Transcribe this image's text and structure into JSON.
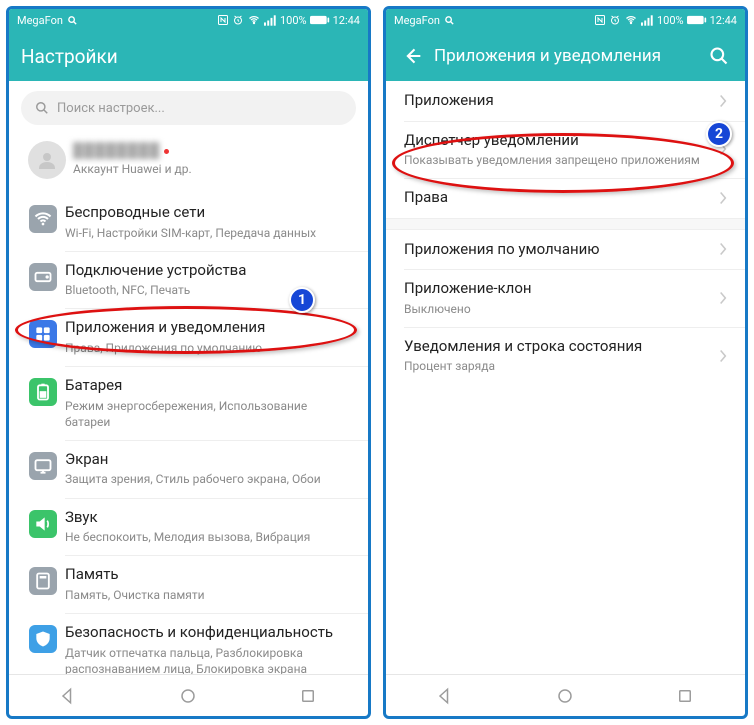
{
  "statusbar": {
    "carrier": "MegaFon",
    "battery_pct": "100%",
    "time": "12:44"
  },
  "screen1": {
    "title": "Настройки",
    "search_placeholder": "Поиск настроек...",
    "account": {
      "name_masked": "████████",
      "sub": "Аккаунт Huawei и др."
    },
    "rows": [
      {
        "title": "Беспроводные сети",
        "sub": "Wi-Fi, Настройки SIM-карт, Передача данных",
        "icon": "wifi",
        "color": "#9aa4ad"
      },
      {
        "title": "Подключение устройства",
        "sub": "Bluetooth, NFC, Печать",
        "icon": "link",
        "color": "#9aa4ad"
      },
      {
        "title": "Приложения и уведомления",
        "sub": "Права, Приложения по умолчанию",
        "icon": "apps",
        "color": "#3b78e7"
      },
      {
        "title": "Батарея",
        "sub": "Режим энергосбережения, Использование батареи",
        "icon": "battery",
        "color": "#3bc46a"
      },
      {
        "title": "Экран",
        "sub": "Защита зрения, Стиль рабочего экрана, Обои",
        "icon": "display",
        "color": "#9aa4ad"
      },
      {
        "title": "Звук",
        "sub": "Не беспокоить, Мелодия вызова, Вибрация",
        "icon": "sound",
        "color": "#3bc46a"
      },
      {
        "title": "Память",
        "sub": "Память, Очистка памяти",
        "icon": "storage",
        "color": "#9aa4ad"
      },
      {
        "title": "Безопасность и конфиденциальность",
        "sub": "Датчик отпечатка пальца, Разблокировка распознаванием лица, Блокировка экрана",
        "icon": "shield",
        "color": "#3ea0e6"
      }
    ]
  },
  "screen2": {
    "title": "Приложения и уведомления",
    "rows_a": [
      {
        "title": "Приложения",
        "sub": ""
      },
      {
        "title": "Диспетчер уведомлений",
        "sub": "Показывать уведомления запрещено приложениям"
      },
      {
        "title": "Права",
        "sub": ""
      }
    ],
    "rows_b": [
      {
        "title": "Приложения по умолчанию",
        "sub": ""
      },
      {
        "title": "Приложение-клон",
        "sub": "Выключено"
      },
      {
        "title": "Уведомления и строка состояния",
        "sub": "Процент заряда"
      }
    ]
  },
  "callouts": {
    "c1": "1",
    "c2": "2"
  }
}
